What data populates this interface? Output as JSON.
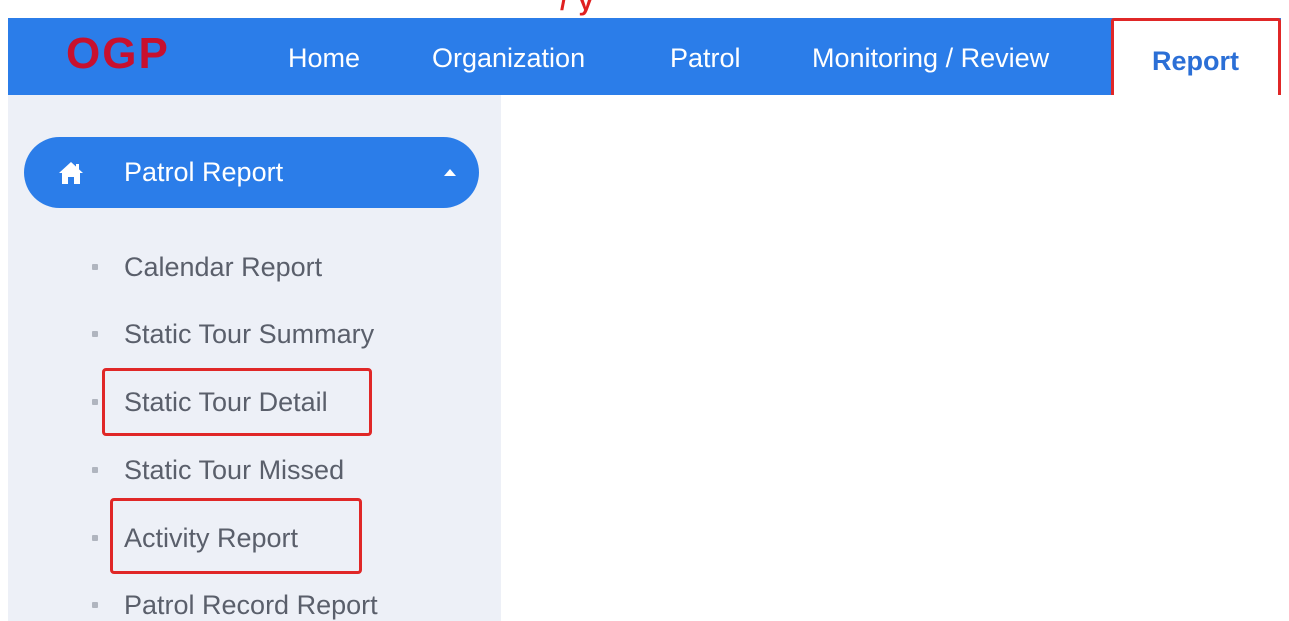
{
  "top_fragment": "/ y",
  "navbar": {
    "logo": "OGP",
    "items": [
      {
        "label": "Home"
      },
      {
        "label": "Organization"
      },
      {
        "label": "Patrol"
      },
      {
        "label": "Monitoring / Review"
      },
      {
        "label": "Report",
        "active": true
      }
    ],
    "background_color": "#2b7de9",
    "logo_color": "#c8102e",
    "highlight_color": "#e02727"
  },
  "sidebar": {
    "section": {
      "label": "Patrol Report",
      "icon": "home-icon",
      "expanded": true,
      "caret_icon": "caret-up-icon"
    },
    "items": [
      {
        "label": "Calendar Report"
      },
      {
        "label": "Static Tour Summary"
      },
      {
        "label": "Static Tour Detail",
        "highlighted": true
      },
      {
        "label": "Static Tour Missed"
      },
      {
        "label": "Activity Report",
        "highlighted": true
      },
      {
        "label": "Patrol Record Report"
      }
    ]
  }
}
